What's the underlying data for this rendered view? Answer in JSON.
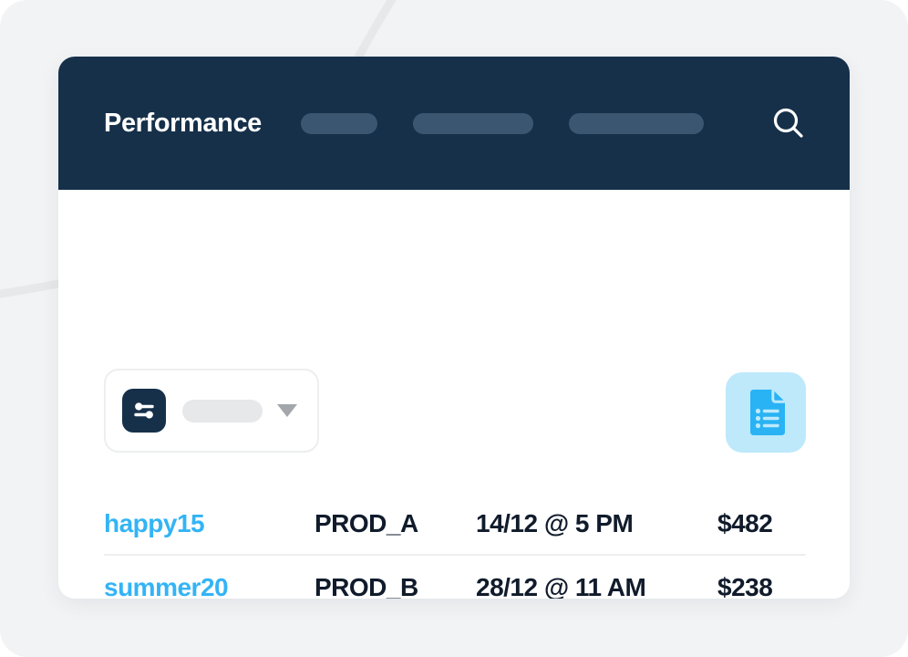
{
  "header": {
    "title": "Performance",
    "nav_placeholders": [
      "",
      "",
      ""
    ],
    "search_icon": "search-icon"
  },
  "toolbar": {
    "filter_icon": "sliders-filter-icon",
    "filter_value": "",
    "dropdown_icon": "chevron-down-icon",
    "report_icon": "document-list-icon"
  },
  "table": {
    "rows": [
      {
        "code": "happy15",
        "product": "PROD_A",
        "date": "14/12 @ 5 PM",
        "price": "$482"
      },
      {
        "code": "summer20",
        "product": "PROD_B",
        "date": "28/12 @ 11 AM",
        "price": "$238"
      }
    ]
  },
  "colors": {
    "header_bg": "#16304a",
    "accent_blue": "#33b4f5",
    "report_tile_bg": "#bde9fb",
    "page_bg": "#f2f3f5",
    "text_dark": "#101b2b",
    "skeleton_nav": "#3b5670",
    "skeleton_light": "#e6e8ea",
    "divider": "#eceef0"
  }
}
